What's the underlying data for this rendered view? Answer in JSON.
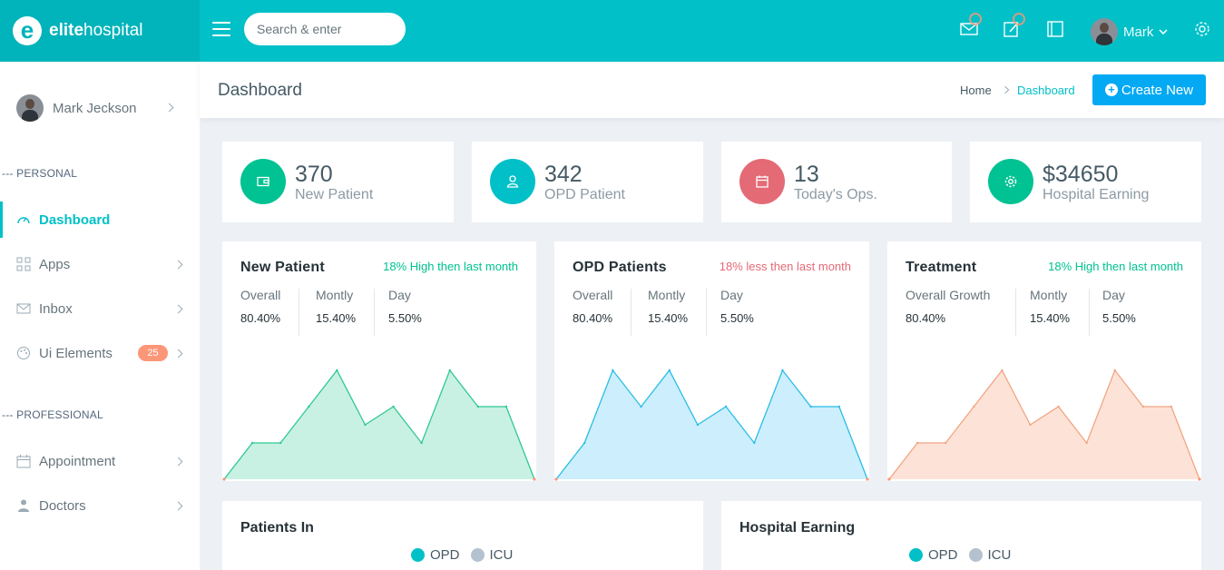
{
  "brand": {
    "name_bold": "elite",
    "name_rest": "hospital",
    "logo_letter": "e"
  },
  "topbar": {
    "search_placeholder": "Search & enter",
    "user_name": "Mark",
    "icons": [
      "menu-icon",
      "mail-icon",
      "edit-icon",
      "book-icon",
      "gear-icon"
    ]
  },
  "sidebar": {
    "user_name": "Mark Jeckson",
    "personal_caption": "--- PERSONAL",
    "professional_caption": "--- PROFESSIONAL",
    "items": [
      {
        "label": "Dashboard",
        "icon": "gauge-icon",
        "active": true
      },
      {
        "label": "Apps",
        "icon": "grid-icon"
      },
      {
        "label": "Inbox",
        "icon": "mail-icon"
      },
      {
        "label": "Ui Elements",
        "icon": "palette-icon",
        "badge": "25"
      },
      {
        "label": "Appointment",
        "icon": "calendar-icon"
      },
      {
        "label": "Doctors",
        "icon": "doctor-icon"
      }
    ]
  },
  "header": {
    "title": "Dashboard",
    "breadcrumb_home": "Home",
    "breadcrumb_current": "Dashboard",
    "create_label": "Create New"
  },
  "stats": [
    {
      "value": "370",
      "label": "New Patient",
      "color": "#00c292",
      "icon": "wallet-icon"
    },
    {
      "value": "342",
      "label": "OPD Patient",
      "color": "#01c0c8",
      "icon": "user-icon"
    },
    {
      "value": "13",
      "label": "Today's Ops.",
      "color": "#e46a76",
      "icon": "calendar-icon"
    },
    {
      "value": "$34650",
      "label": "Hospital Earning",
      "color": "#00c292",
      "icon": "gear-icon"
    }
  ],
  "cards": [
    {
      "title": "New Patient",
      "trend": "18% High then last month",
      "trend_color": "#00c292",
      "stats": [
        {
          "k": "Overall",
          "v": "80.40%"
        },
        {
          "k": "Montly",
          "v": "15.40%"
        },
        {
          "k": "Day",
          "v": "5.50%"
        }
      ],
      "stroke": "#2ec98f",
      "fill": "#c8f1e3"
    },
    {
      "title": "OPD Patients",
      "trend": "18% less then last month",
      "trend_color": "#e46a76",
      "stats": [
        {
          "k": "Overall",
          "v": "80.40%"
        },
        {
          "k": "Montly",
          "v": "15.40%"
        },
        {
          "k": "Day",
          "v": "5.50%"
        }
      ],
      "stroke": "#28bde6",
      "fill": "#cdeefc"
    },
    {
      "title": "Treatment",
      "trend": "18% High then last month",
      "trend_color": "#00c292",
      "stats": [
        {
          "k": "Overall Growth",
          "v": "80.40%"
        },
        {
          "k": "Montly",
          "v": "15.40%"
        },
        {
          "k": "Day",
          "v": "5.50%"
        }
      ],
      "stroke": "#f2a482",
      "fill": "#fde3d7"
    }
  ],
  "chart_data": [
    {
      "type": "area",
      "x": [
        1,
        2,
        3,
        4,
        5,
        6,
        7,
        8,
        9,
        10,
        11,
        12
      ],
      "values": [
        0,
        2,
        2,
        4,
        6,
        3,
        4,
        2,
        6,
        4,
        4,
        0
      ],
      "ylim": [
        0,
        6.3
      ]
    },
    {
      "type": "area",
      "x": [
        1,
        2,
        3,
        4,
        5,
        6,
        7,
        8,
        9,
        10,
        11,
        12
      ],
      "values": [
        0,
        2,
        6,
        4,
        6,
        3,
        4,
        2,
        6,
        4,
        4,
        0
      ],
      "ylim": [
        0,
        6.3
      ]
    },
    {
      "type": "area",
      "x": [
        1,
        2,
        3,
        4,
        5,
        6,
        7,
        8,
        9,
        10,
        11,
        12
      ],
      "values": [
        0,
        2,
        2,
        4,
        6,
        3,
        4,
        2,
        6,
        4,
        4,
        0
      ],
      "ylim": [
        0,
        6.3
      ]
    }
  ],
  "bottom": {
    "patients_title": "Patients In",
    "earning_title": "Hospital Earning",
    "legend": [
      {
        "label": "OPD",
        "color": "#01c0c8"
      },
      {
        "label": "ICU",
        "color": "#b4c1ce"
      }
    ]
  }
}
